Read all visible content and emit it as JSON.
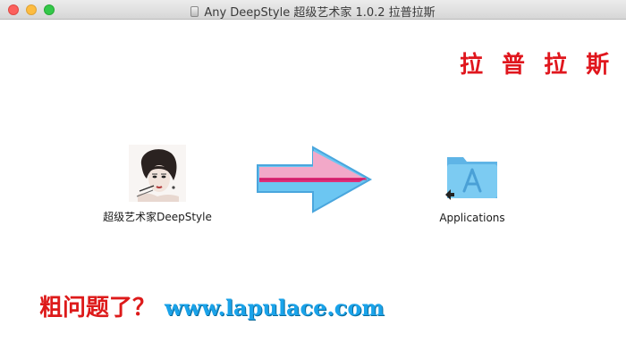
{
  "window": {
    "title": "Any DeepStyle 超级艺术家 1.0.2 拉普拉斯",
    "title_icon": "disk-image-icon",
    "controls": [
      "close",
      "minimize",
      "maximize"
    ]
  },
  "watermark_top": "拉 普 拉 斯",
  "installer": {
    "app": {
      "label": "超级艺术家DeepStyle",
      "icon": "app-portrait-icon"
    },
    "arrow": {
      "icon": "drag-arrow-icon",
      "colors": {
        "pink": "#f2a8c8",
        "magenta": "#e0307a",
        "blue": "#6cc6f2"
      }
    },
    "folder": {
      "label": "Applications",
      "icon": "applications-folder-icon",
      "color": "#6ec3ee"
    }
  },
  "watermark_bottom": {
    "question": "粗问题了？",
    "url": "www.lapulace.com"
  }
}
